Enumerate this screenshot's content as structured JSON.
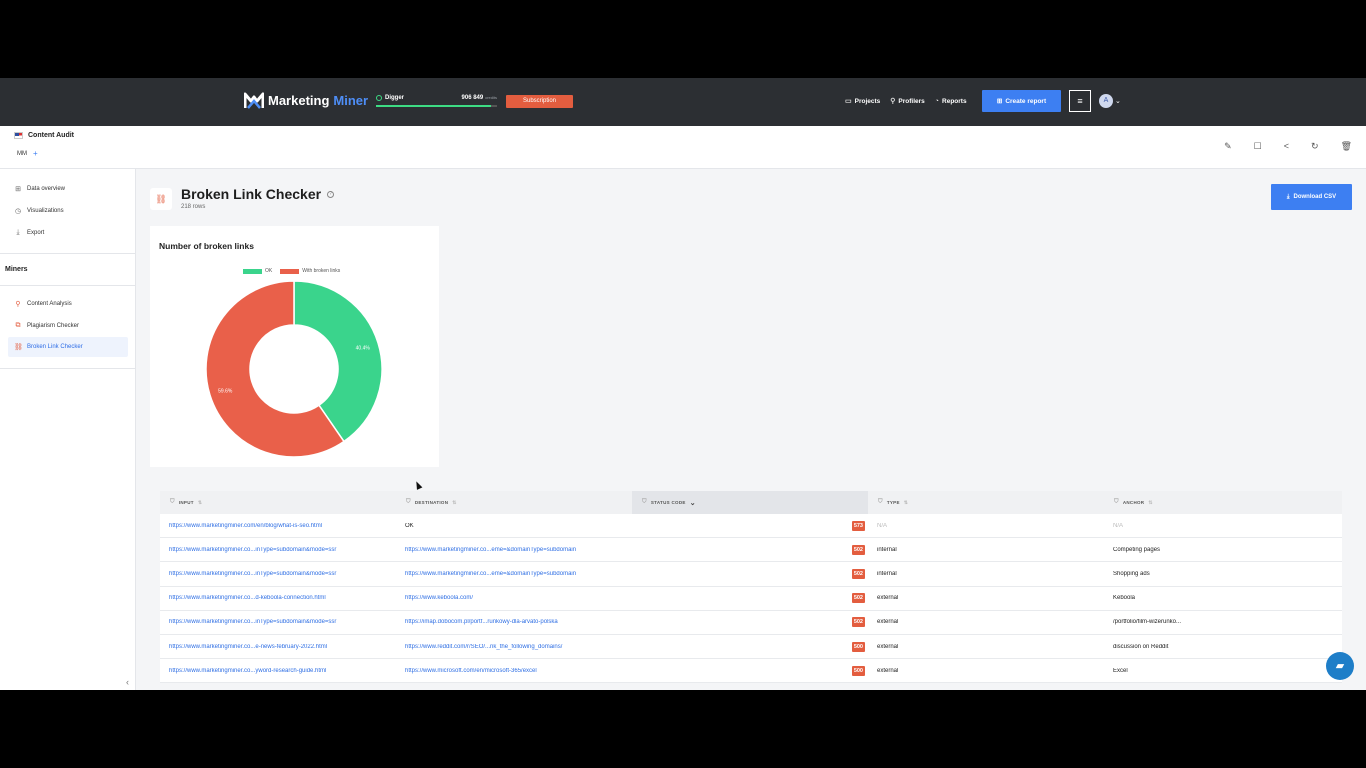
{
  "topbar": {
    "brand_part1": "Marketing",
    "brand_part2": "Miner",
    "plan_name": "Digger",
    "credits": "906 849",
    "credits_unit": "credits",
    "credits_fraction": 0.95,
    "subscription_label": "Subscription",
    "nav": [
      {
        "label": "Projects",
        "icon": "folder-icon"
      },
      {
        "label": "Profilers",
        "icon": "search-icon"
      },
      {
        "label": "Reports",
        "icon": "reports-icon"
      }
    ],
    "create_label": "Create report",
    "avatar_initial": "A"
  },
  "project": {
    "title": "Content Audit",
    "tag": "MM",
    "add": "+"
  },
  "sidebar": {
    "items": [
      {
        "label": "Data overview",
        "icon": "grid-icon"
      },
      {
        "label": "Visualizations",
        "icon": "chart-icon"
      },
      {
        "label": "Export",
        "icon": "download-icon"
      }
    ],
    "miners_heading": "Miners",
    "miners": [
      {
        "label": "Content Analysis",
        "icon": "search-icon"
      },
      {
        "label": "Plagiarism Checker",
        "icon": "copy-icon"
      },
      {
        "label": "Broken Link Checker",
        "icon": "broken-link-icon",
        "active": true
      }
    ]
  },
  "page": {
    "title": "Broken Link Checker",
    "rows": "218 rows",
    "download_label": "Download CSV"
  },
  "chart_data": {
    "type": "pie",
    "donut": true,
    "title": "Number of broken links",
    "series": [
      {
        "name": "OK",
        "value": 40.4,
        "label": "40.4%",
        "color": "#3ad48c"
      },
      {
        "name": "With broken links",
        "value": 59.6,
        "label": "59.6%",
        "color": "#e9604a"
      }
    ],
    "legend_position": "top"
  },
  "table": {
    "columns": [
      "INPUT",
      "DESTINATION",
      "STATUS CODE",
      "TYPE",
      "ANCHOR"
    ],
    "sorted_column": "STATUS CODE",
    "rows": [
      {
        "input": "https://www.marketingminer.com/en/blog/what-is-seo.html",
        "destination": "OK",
        "status": "573",
        "type": "N/A",
        "anchor": "N/A"
      },
      {
        "input": "https://www.marketingminer.co...inType=subdomain&mode=ssr",
        "destination": "https://www.marketingminer.co...eme=&domainType=subdomain",
        "status": "502",
        "type": "internal",
        "anchor": "Competing pages"
      },
      {
        "input": "https://www.marketingminer.co...inType=subdomain&mode=ssr",
        "destination": "https://www.marketingminer.co...eme=&domainType=subdomain",
        "status": "502",
        "type": "internal",
        "anchor": "Shopping ads"
      },
      {
        "input": "https://www.marketingminer.co...d-keboola-connection.html",
        "destination": "https://www.keboola.com/",
        "status": "502",
        "type": "external",
        "anchor": "Keboola"
      },
      {
        "input": "https://www.marketingminer.co...inType=subdomain&mode=ssr",
        "destination": "https://imap.dobocom.pl/portf...runkowy-dla-arvato-polska",
        "status": "502",
        "type": "external",
        "anchor": "/portfolio/film-wizerunko..."
      },
      {
        "input": "https://www.marketingminer.co...e-news-february-2022.html",
        "destination": "https://www.reddit.com/r/SEO/...nk_the_following_domains/",
        "status": "500",
        "type": "external",
        "anchor": "discussion on Reddit"
      },
      {
        "input": "https://www.marketingminer.co...yword-research-guide.html",
        "destination": "https://www.microsoft.com/en/microsoft-365/excel",
        "status": "500",
        "type": "external",
        "anchor": "Excel"
      }
    ]
  }
}
